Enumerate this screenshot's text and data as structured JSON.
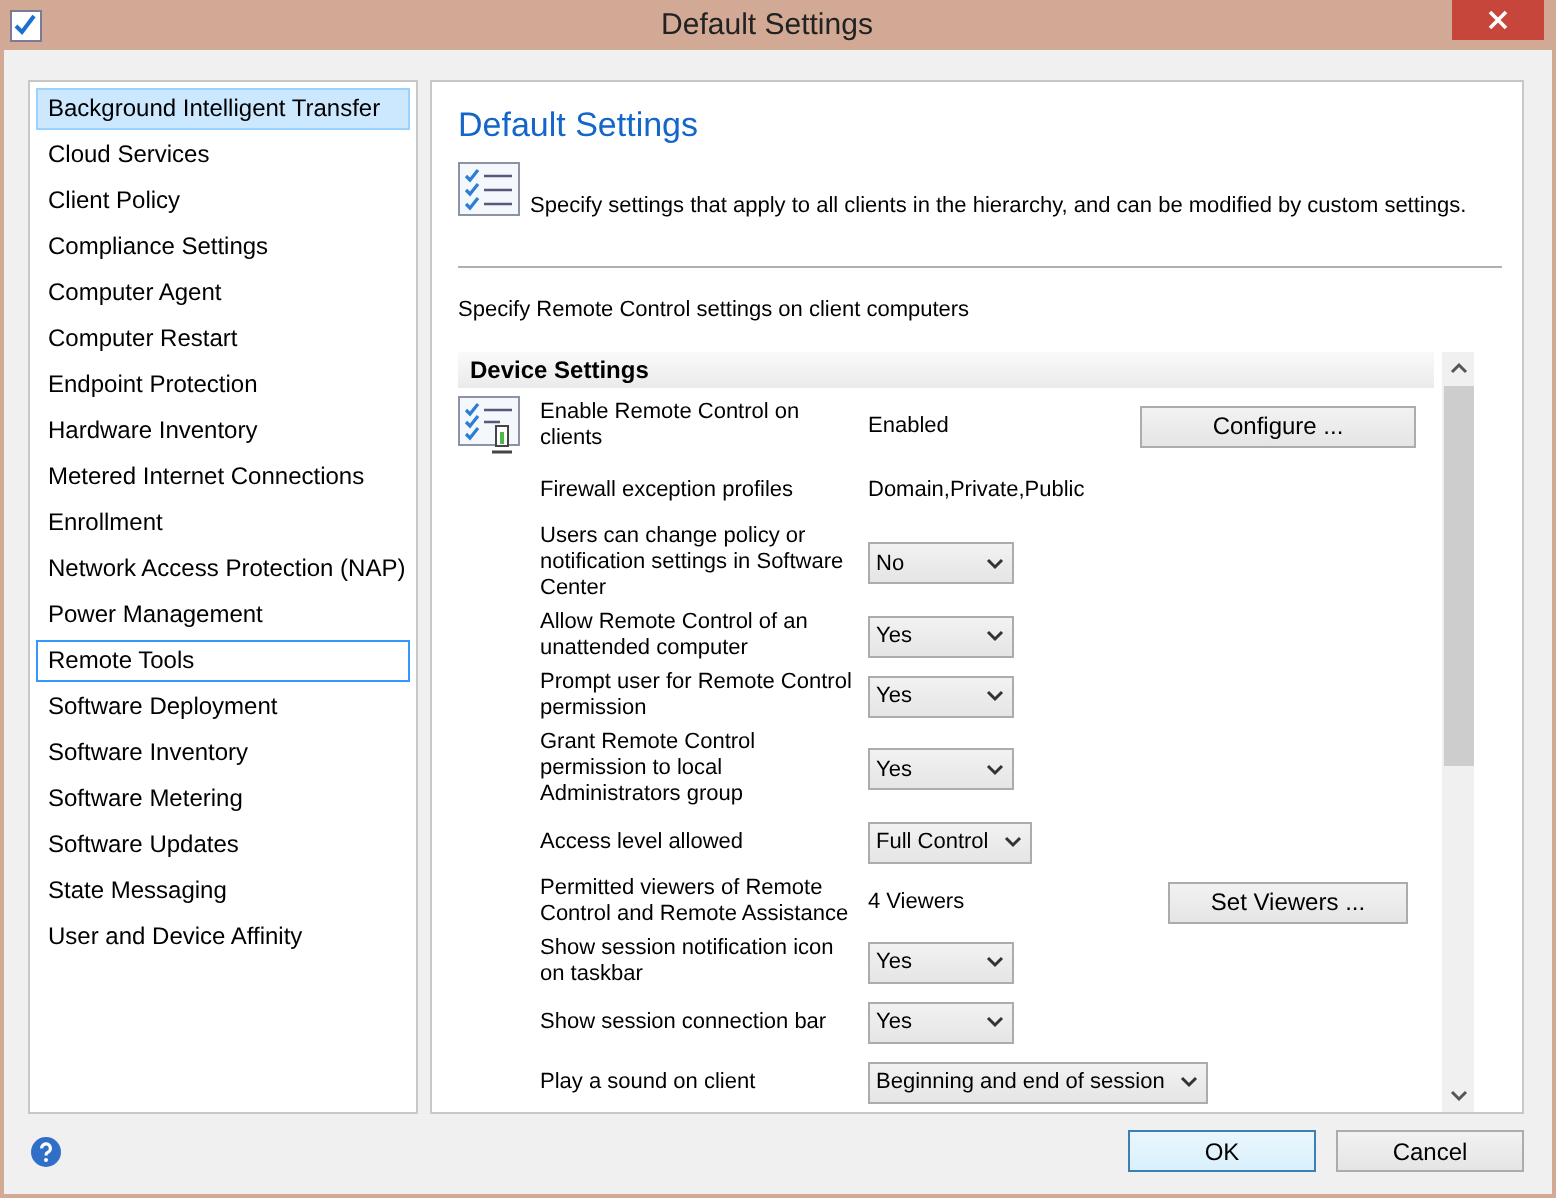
{
  "window": {
    "title": "Default Settings"
  },
  "sidebar": {
    "items": [
      {
        "label": "Background Intelligent Transfer",
        "selected": true,
        "focused": false
      },
      {
        "label": "Cloud Services",
        "selected": false,
        "focused": false
      },
      {
        "label": "Client Policy",
        "selected": false,
        "focused": false
      },
      {
        "label": "Compliance Settings",
        "selected": false,
        "focused": false
      },
      {
        "label": "Computer Agent",
        "selected": false,
        "focused": false
      },
      {
        "label": "Computer Restart",
        "selected": false,
        "focused": false
      },
      {
        "label": "Endpoint Protection",
        "selected": false,
        "focused": false
      },
      {
        "label": "Hardware Inventory",
        "selected": false,
        "focused": false
      },
      {
        "label": "Metered Internet Connections",
        "selected": false,
        "focused": false
      },
      {
        "label": "Enrollment",
        "selected": false,
        "focused": false
      },
      {
        "label": "Network Access Protection (NAP)",
        "selected": false,
        "focused": false
      },
      {
        "label": "Power Management",
        "selected": false,
        "focused": false
      },
      {
        "label": "Remote Tools",
        "selected": false,
        "focused": true
      },
      {
        "label": "Software Deployment",
        "selected": false,
        "focused": false
      },
      {
        "label": "Software Inventory",
        "selected": false,
        "focused": false
      },
      {
        "label": "Software Metering",
        "selected": false,
        "focused": false
      },
      {
        "label": "Software Updates",
        "selected": false,
        "focused": false
      },
      {
        "label": "State Messaging",
        "selected": false,
        "focused": false
      },
      {
        "label": "User and Device Affinity",
        "selected": false,
        "focused": false
      }
    ]
  },
  "content": {
    "title": "Default Settings",
    "description": "Specify settings that apply to all clients in the hierarchy, and can be modified by custom settings.",
    "subtitle": "Specify Remote Control settings on client computers",
    "section": "Device Settings",
    "rows": [
      {
        "label": "Enable Remote Control on clients",
        "kind": "text",
        "value": "Enabled",
        "button": "Configure ..."
      },
      {
        "label": "Firewall exception profiles",
        "kind": "text",
        "value": "Domain,Private,Public"
      },
      {
        "label": "Users can change policy or notification settings in Software Center",
        "kind": "dropdown",
        "value": "No"
      },
      {
        "label": "Allow Remote Control of an unattended computer",
        "kind": "dropdown",
        "value": "Yes"
      },
      {
        "label": "Prompt user for Remote Control permission",
        "kind": "dropdown",
        "value": "Yes"
      },
      {
        "label": "Grant Remote Control permission to local Administrators group",
        "kind": "dropdown",
        "value": "Yes"
      },
      {
        "label": "Access level allowed",
        "kind": "dropdown",
        "value": "Full Control"
      },
      {
        "label": "Permitted viewers of Remote Control and Remote Assistance",
        "kind": "text",
        "value": "4 Viewers",
        "button": "Set Viewers ..."
      },
      {
        "label": "Show session notification icon on taskbar",
        "kind": "dropdown",
        "value": "Yes"
      },
      {
        "label": "Show session connection bar",
        "kind": "dropdown",
        "value": "Yes"
      },
      {
        "label": "Play a sound on client",
        "kind": "dropdown",
        "value": "Beginning and end of session"
      }
    ]
  },
  "footer": {
    "buttons": [
      {
        "label": "OK",
        "default": true
      },
      {
        "label": "Cancel",
        "default": false
      }
    ]
  }
}
